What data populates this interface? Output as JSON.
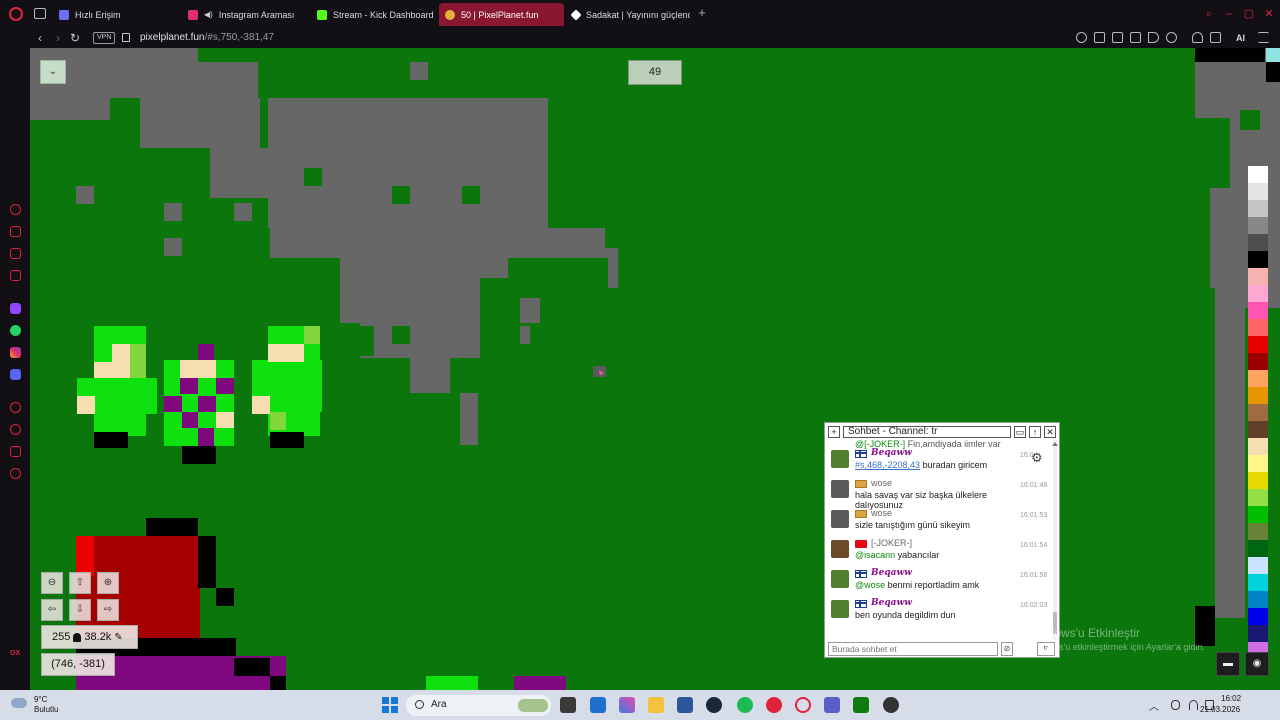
{
  "browser": {
    "tabs": [
      {
        "label": "Hızlı Erişim",
        "favicon_color": "#6d6df0",
        "favicon": "speed-dial-icon"
      },
      {
        "label": "Instagram Araması",
        "favicon_color": "#e1306c",
        "favicon": "instagram-icon"
      },
      {
        "label": "Stream - Kick Dashboard",
        "favicon_color": "#53fc18",
        "favicon": "kick-icon"
      },
      {
        "label": "50 | PixelPlanet.fun",
        "favicon_color": "#e8b03a",
        "favicon": "pixelplanet-icon"
      },
      {
        "label": "Sadakat | Yayınını güçlend",
        "favicon_color": "#ffffff",
        "favicon": "sadakat-icon"
      }
    ],
    "vpn_label": "VPN",
    "url_host": "pixelplanet.fun",
    "url_path": "/#s,750,-381,47",
    "ai_label": "AI"
  },
  "canvas": {
    "online_count": "49",
    "menu_toggle_glyph": "⌄"
  },
  "controls": {
    "zoom_out": "⊖",
    "move_up": "⇧",
    "zoom_in": "⊕",
    "move_left": "⇦",
    "move_down": "⇩",
    "move_right": "⇨",
    "pixel_count": "255",
    "online_total": "38.2k",
    "coordinates": "(746, -381)"
  },
  "palette": {
    "colors": [
      "#ffffff",
      "#e4e4e4",
      "#c4c4c4",
      "#888888",
      "#4e4e4e",
      "#000000",
      "#f4b3ae",
      "#ffa7d1",
      "#ff54b2",
      "#ff6565",
      "#e50000",
      "#9a0000",
      "#fea460",
      "#e59500",
      "#a06a42",
      "#604028",
      "#f5dfb0",
      "#fff889",
      "#e5d900",
      "#94e044",
      "#02be01",
      "#688338",
      "#006513",
      "#cae3ff",
      "#00d3dd",
      "#0083c7",
      "#0000ea",
      "#191973",
      "#cf6ee4",
      "#820080"
    ]
  },
  "chat": {
    "title": "Sohbet - Channel: tr",
    "input_placeholder": "Burada sohbet et",
    "language": "tr",
    "top_partial": {
      "mention": "@[-JOKER-]",
      "text": " Fin,amdiyada iimler var"
    },
    "messages": [
      {
        "name": "Beqaww",
        "fancy": true,
        "flag": "fi",
        "time": "16:0..",
        "link": "#s,468,-2208,43",
        "text": " buradan giricem",
        "avatar_color": "#4f7f2f"
      },
      {
        "name": "wose",
        "fancy": false,
        "flag": "unknown",
        "time": "16:01:48",
        "text": "hala savaş var siz başka ülkelere dalıyosunuz",
        "avatar_color": "#5b5b5b"
      },
      {
        "name": "wose",
        "fancy": false,
        "flag": "unknown",
        "time": "16:01:53",
        "text": "sizle tanıştığım günü sikeyim",
        "avatar_color": "#5b5b5b"
      },
      {
        "name": "[-JOKER-]",
        "fancy": false,
        "flag": "tr",
        "time": "16:01:54",
        "mention": "@isacann",
        "text": " yabancılar",
        "avatar_color": "#6b4a2a"
      },
      {
        "name": "Beqaww",
        "fancy": true,
        "flag": "fi",
        "time": "16:01:58",
        "mention": "@wose",
        "text": " benmi reportladim amk",
        "avatar_color": "#4f7f2f"
      },
      {
        "name": "Beqaww",
        "fancy": true,
        "flag": "fi",
        "time": "16:02:03",
        "text": "ben oyunda degildim dun",
        "avatar_color": "#4f7f2f"
      }
    ]
  },
  "watermark": {
    "line1": "Windows'u Etkinleştir",
    "line2": "Windows'u etkinleştirmek için Ayarlar'a gidin."
  },
  "taskbar": {
    "weather_temp": "9°C",
    "weather_cond": "Bulutlu",
    "search_label": "Ara",
    "time": "16:02",
    "date": "21.03.2026"
  }
}
